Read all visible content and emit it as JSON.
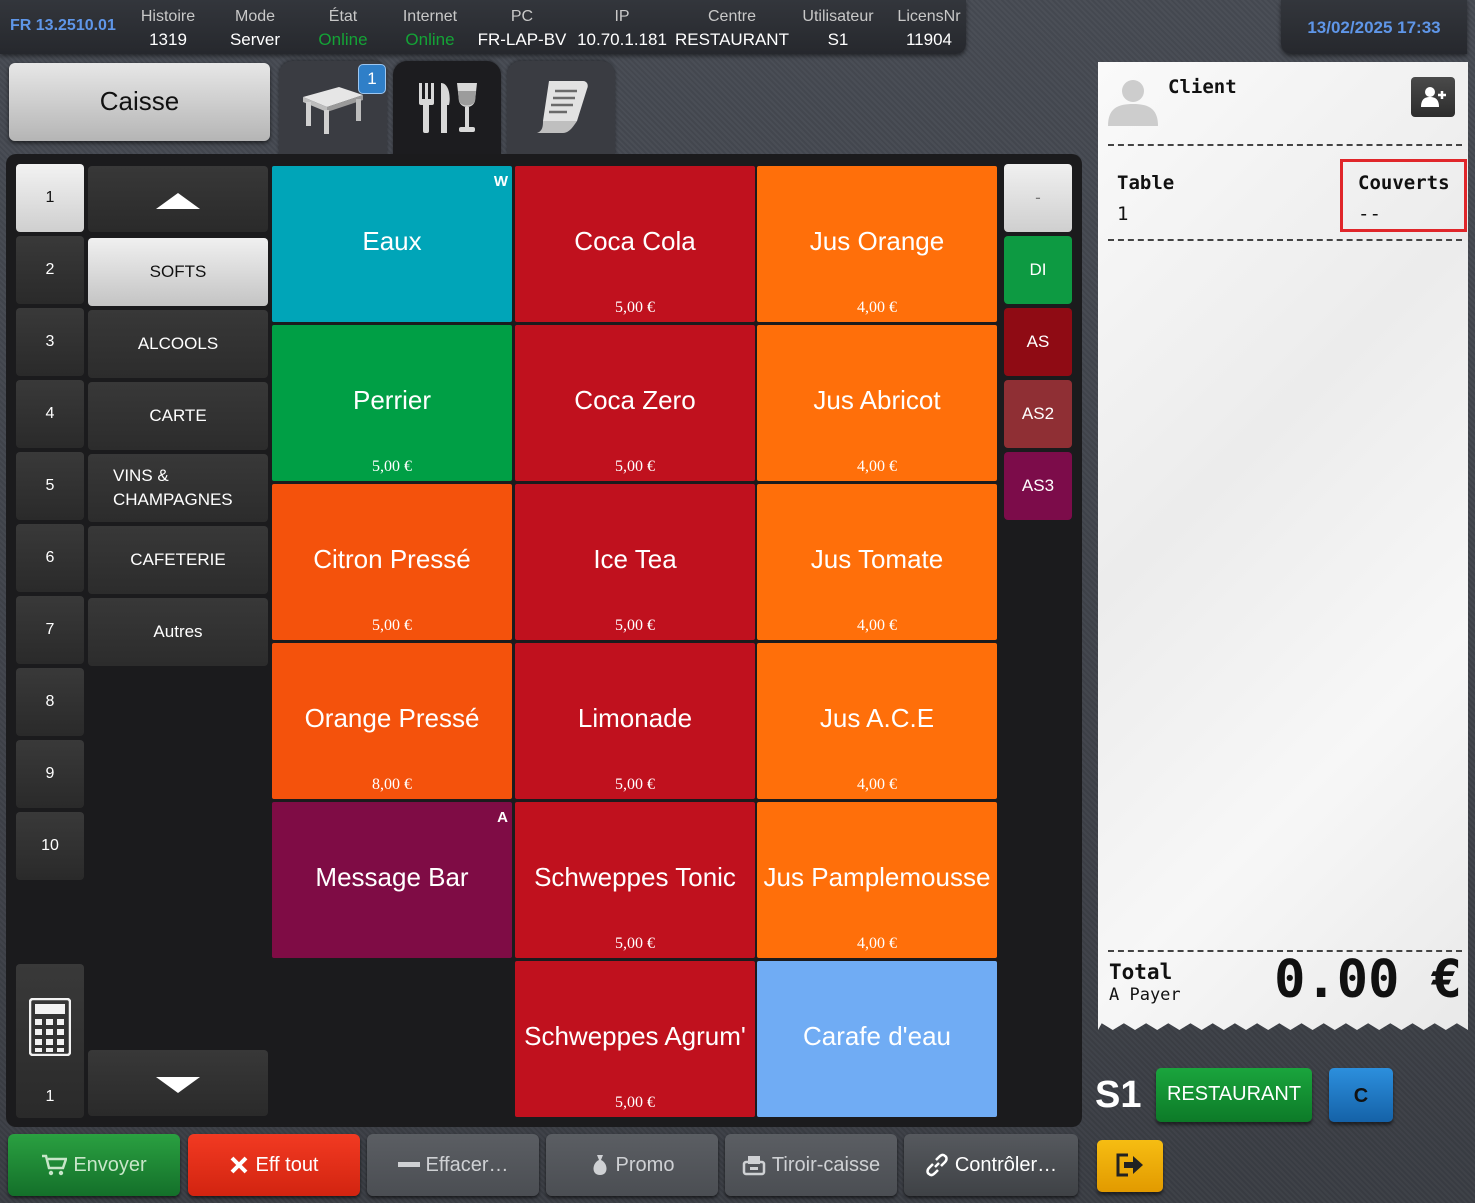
{
  "status": {
    "version": "FR 13.2510.01",
    "items": [
      {
        "label": "Histoire",
        "value": "1319"
      },
      {
        "label": "Mode",
        "value": "Server"
      },
      {
        "label": "État",
        "value": "Online"
      },
      {
        "label": "Internet",
        "value": "Online"
      },
      {
        "label": "PC",
        "value": "FR-LAP-BV"
      },
      {
        "label": "IP",
        "value": "10.70.1.181"
      },
      {
        "label": "Centre",
        "value": "RESTAURANT"
      },
      {
        "label": "Utilisateur",
        "value": "S1"
      },
      {
        "label": "LicensNr",
        "value": "11904"
      }
    ],
    "datetime": "13/02/2025 17:33"
  },
  "caisse_label": "Caisse",
  "tabs": [
    {
      "icon": "table-icon",
      "badge": "1"
    },
    {
      "icon": "cutlery-glass-icon",
      "active": true
    },
    {
      "icon": "receipt-scroll-icon"
    }
  ],
  "seat_numbers": [
    "1",
    "2",
    "3",
    "4",
    "5",
    "6",
    "7",
    "8",
    "9",
    "10"
  ],
  "selected_seat": "1",
  "calculator_value": "1",
  "categories": [
    {
      "label": "SOFTS",
      "selected": true
    },
    {
      "label": "ALCOOLS"
    },
    {
      "label": "CARTE"
    },
    {
      "label": "VINS & CHAMPAGNES"
    },
    {
      "label": "CAFETERIE"
    },
    {
      "label": "Autres"
    }
  ],
  "products": [
    {
      "name": "Eaux",
      "price": "",
      "color": "#00a5b8",
      "corner": "W"
    },
    {
      "name": "Coca Cola",
      "price": "5,00 €",
      "color": "#c0111e"
    },
    {
      "name": "Jus Orange",
      "price": "4,00 €",
      "color": "#ff6f0a"
    },
    {
      "name": "Perrier",
      "price": "5,00 €",
      "color": "#009f45"
    },
    {
      "name": "Coca Zero",
      "price": "5,00 €",
      "color": "#c0111e"
    },
    {
      "name": "Jus Abricot",
      "price": "4,00 €",
      "color": "#ff6f0a"
    },
    {
      "name": "Citron Pressé",
      "price": "5,00 €",
      "color": "#f4520c"
    },
    {
      "name": "Ice Tea",
      "price": "5,00 €",
      "color": "#c0111e"
    },
    {
      "name": "Jus Tomate",
      "price": "4,00 €",
      "color": "#ff6f0a"
    },
    {
      "name": "Orange Pressé",
      "price": "8,00 €",
      "color": "#f4520c"
    },
    {
      "name": "Limonade",
      "price": "5,00 €",
      "color": "#c0111e"
    },
    {
      "name": "Jus A.C.E",
      "price": "4,00 €",
      "color": "#ff6f0a"
    },
    {
      "name": "Message Bar",
      "price": "",
      "color": "#7f0c45",
      "corner": "A"
    },
    {
      "name": "Schweppes Tonic",
      "price": "5,00 €",
      "color": "#c0111e"
    },
    {
      "name": "Jus Pamplemousse",
      "price": "4,00 €",
      "color": "#ff6f0a"
    },
    {
      "name": "",
      "price": "",
      "color": "",
      "empty": true
    },
    {
      "name": "Schweppes Agrum'",
      "price": "5,00 €",
      "color": "#c0111e"
    },
    {
      "name": "Carafe d'eau",
      "price": "",
      "color": "#70acf4"
    }
  ],
  "modifiers": [
    {
      "label": "-",
      "color": "#d4d4d4"
    },
    {
      "label": "DI",
      "color": "#0d9a42"
    },
    {
      "label": "AS",
      "color": "#8f0b14"
    },
    {
      "label": "AS2",
      "color": "#8f2f34"
    },
    {
      "label": "AS3",
      "color": "#7c0c4a"
    }
  ],
  "bottom_buttons": [
    {
      "label": "Envoyer",
      "icon": "cart-icon",
      "enabled": true,
      "color": "#1f8a33"
    },
    {
      "label": "Eff tout",
      "icon": "x-icon",
      "enabled": true,
      "color": "#e52f1c"
    },
    {
      "label": "Effacer…",
      "icon": "minus-icon",
      "enabled": false
    },
    {
      "label": "Promo",
      "icon": "money-bag-icon",
      "enabled": false
    },
    {
      "label": "Tiroir-caisse",
      "icon": "drawer-icon",
      "enabled": false
    },
    {
      "label": "Contrôler…",
      "icon": "link-icon",
      "enabled": true,
      "color": "#4a4c50"
    }
  ],
  "receipt": {
    "client_label": "Client",
    "table_label": "Table",
    "table_value": "1",
    "couverts_label": "Couverts",
    "couverts_value": "--",
    "total_label": "Total",
    "a_payer_label": "A Payer",
    "total_value": "0.00 €"
  },
  "footer": {
    "user": "S1",
    "centre_button": "RESTAURANT",
    "c_button": "C"
  }
}
